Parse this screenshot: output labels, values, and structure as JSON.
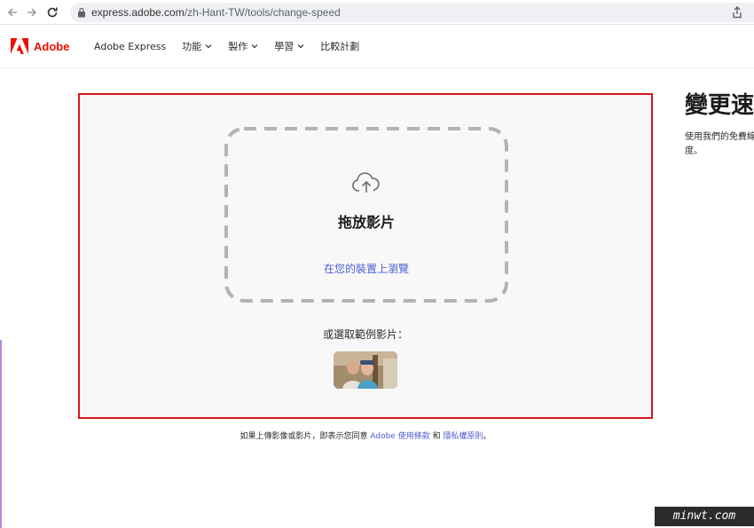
{
  "browser": {
    "url_host": "express.adobe.com",
    "url_path": "/zh-Hant-TW/tools/change-speed"
  },
  "header": {
    "logo_text": "Adobe",
    "nav": [
      {
        "label": "Adobe Express",
        "has_menu": false
      },
      {
        "label": "功能",
        "has_menu": true
      },
      {
        "label": "製作",
        "has_menu": true
      },
      {
        "label": "學習",
        "has_menu": true
      },
      {
        "label": "比較計劃",
        "has_menu": false
      }
    ]
  },
  "upload": {
    "title": "拖放影片",
    "browse_link": "在您的裝置上瀏覽",
    "sample_label": "或選取範例影片："
  },
  "side": {
    "title": "變更速",
    "desc_line1": "使用我們的免費線",
    "desc_line2": "度。"
  },
  "terms": {
    "prefix": "如果上傳影像或影片，即表示您同意 ",
    "terms_link": "Adobe 使用條款",
    "middle": " 和 ",
    "privacy_link": "隱私權原則",
    "suffix": "。"
  },
  "watermark": "minwt.com",
  "colors": {
    "accent_red": "#d9161b",
    "adobe_red": "#eb1000",
    "link_blue": "#4b5ed1"
  }
}
